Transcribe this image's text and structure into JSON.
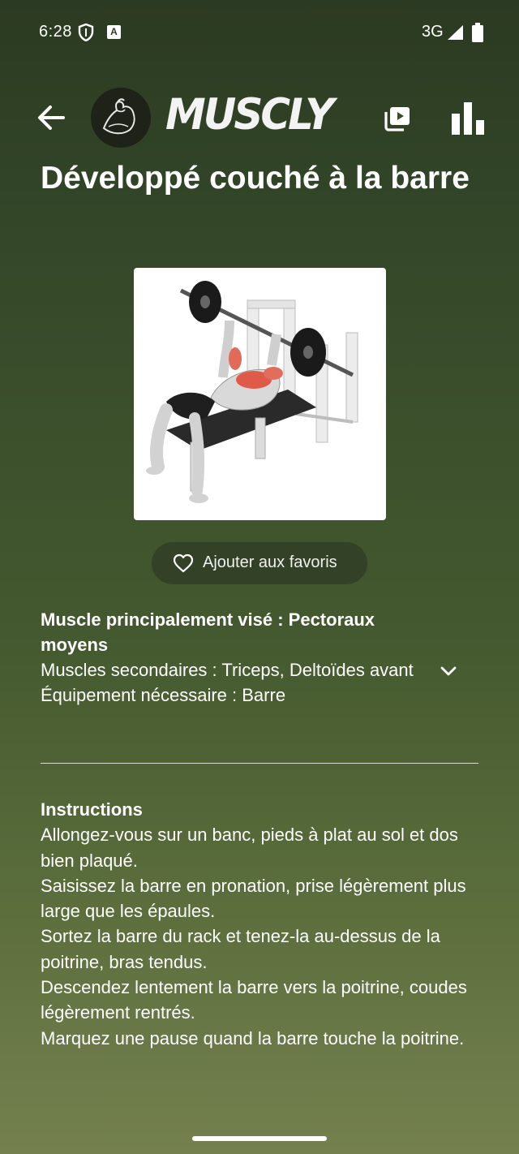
{
  "status_bar": {
    "time": "6:28",
    "network": "3G"
  },
  "app_bar": {
    "logo_text": "MUSCLY",
    "icons": [
      "back-arrow-icon",
      "logo-biceps-icon",
      "video-library-icon",
      "bar-chart-icon"
    ]
  },
  "exercise": {
    "title": "Développé couché à la barre",
    "image_alt": "bench-press-illustration",
    "favorite_label": "Ajouter aux favoris",
    "primary_muscle": "Muscle principalement visé : Pectoraux moyens",
    "secondary_muscles": "Muscles secondaires : Triceps, Deltoïdes avant",
    "equipment": "Équipement nécessaire : Barre"
  },
  "instructions": {
    "title": "Instructions",
    "steps": [
      "Allongez-vous sur un banc, pieds à plat au sol et dos bien plaqué.",
      "Saisissez la barre en pronation, prise légèrement plus large que les épaules.",
      "Sortez la barre du rack et tenez-la au-dessus de la poitrine, bras tendus.",
      "Descendez lentement la barre vers la poitrine, coudes légèrement rentrés.",
      "Marquez une pause quand la barre touche la poitrine."
    ]
  },
  "colors": {
    "background_top": "#2b3a22",
    "background_bottom": "#74814f",
    "text": "#ffffff"
  }
}
